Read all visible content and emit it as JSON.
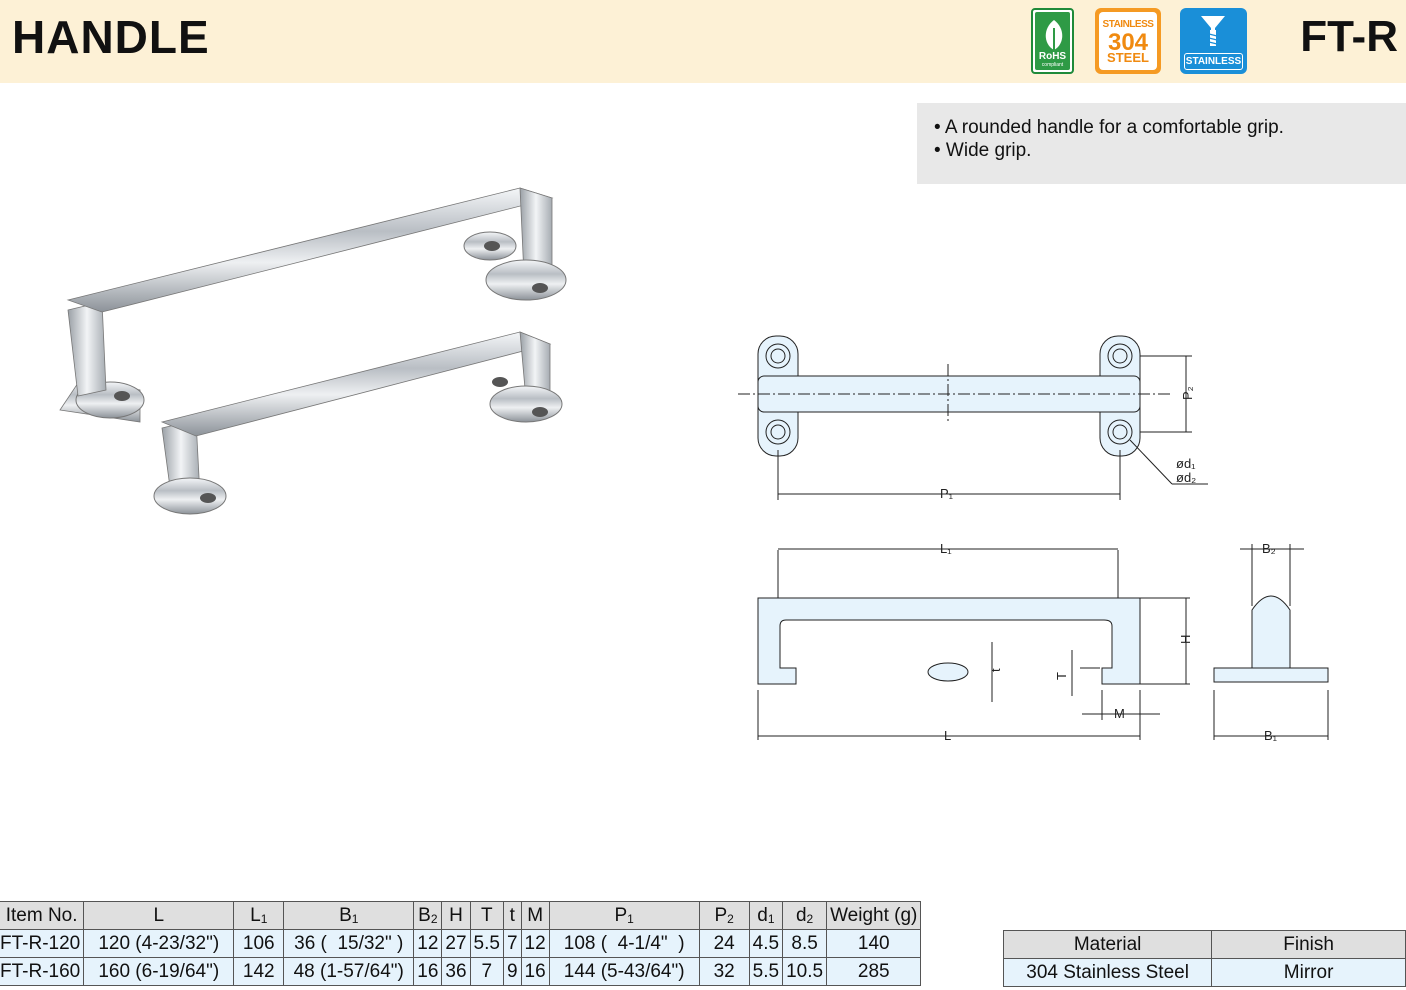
{
  "header": {
    "title": "HANDLE",
    "model": "FT-R",
    "badges": {
      "rohs": {
        "label": "RoHS",
        "sub": "compliant",
        "color": "#2e9a45"
      },
      "stainless304": {
        "line1": "STAINLESS",
        "line2": "304",
        "line3": "STEEL",
        "color": "#f59a23"
      },
      "stainless": {
        "label": "STAINLESS",
        "color": "#1a8fd8"
      }
    }
  },
  "features": [
    "• A rounded handle for a comfortable grip.",
    "• Wide grip."
  ],
  "drawing": {
    "labels": {
      "P1": "P₁",
      "P2": "P₂",
      "d1": "ød₁",
      "d2": "ød₂",
      "L1": "L₁",
      "L": "L",
      "H": "H",
      "T": "T",
      "t": "t",
      "M": "M",
      "B1": "B₁",
      "B2": "B₂"
    }
  },
  "spec_table": {
    "columns": [
      {
        "main": "Item No.",
        "sub": ""
      },
      {
        "main": "L",
        "sub": ""
      },
      {
        "main": "L",
        "sub": "1"
      },
      {
        "main": "B",
        "sub": "1"
      },
      {
        "main": "B",
        "sub": "2"
      },
      {
        "main": "H",
        "sub": ""
      },
      {
        "main": "T",
        "sub": ""
      },
      {
        "main": "t",
        "sub": ""
      },
      {
        "main": "M",
        "sub": ""
      },
      {
        "main": "P",
        "sub": "1"
      },
      {
        "main": "P",
        "sub": "2"
      },
      {
        "main": "d",
        "sub": "1"
      },
      {
        "main": "d",
        "sub": "2"
      },
      {
        "main": "Weight (g)",
        "sub": ""
      }
    ],
    "rows": [
      [
        "FT-R-120",
        "120 (4-23/32\")",
        "106",
        "36 (  15/32\" )",
        "12",
        "27",
        "5.5",
        "7",
        "12",
        "108 (  4-1/4\"  )",
        "24",
        "4.5",
        "8.5",
        "140"
      ],
      [
        "FT-R-160",
        "160 (6-19/64\")",
        "142",
        "48 (1-57/64\")",
        "16",
        "36",
        "7",
        "9",
        "16",
        "144 (5-43/64\")",
        "32",
        "5.5",
        "10.5",
        "285"
      ]
    ]
  },
  "material_table": {
    "headers": [
      "Material",
      "Finish"
    ],
    "row": [
      "304 Stainless Steel",
      "Mirror"
    ]
  }
}
